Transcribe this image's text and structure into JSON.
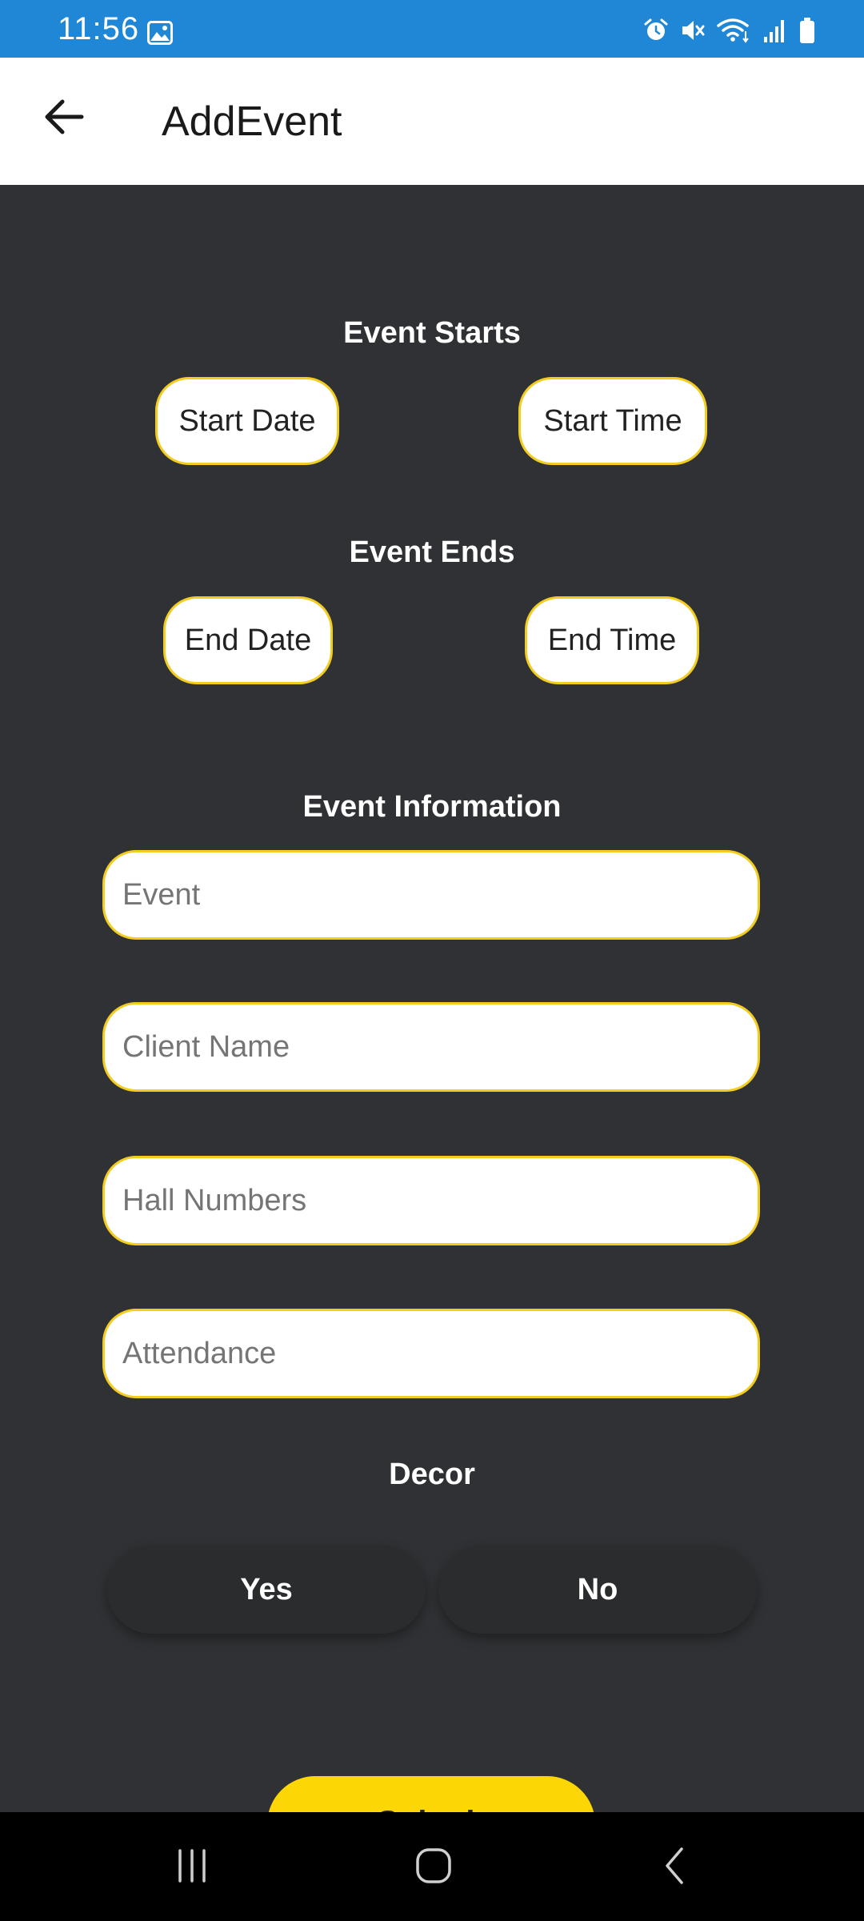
{
  "status_bar": {
    "time": "11:56",
    "icons": [
      "image-icon",
      "alarm-icon",
      "mute-icon",
      "wifi-icon",
      "signal-icon",
      "battery-icon"
    ],
    "color": "#1f87d6"
  },
  "app_bar": {
    "title": "AddEvent",
    "back_icon": "arrow-left-icon"
  },
  "event_starts": {
    "heading": "Event Starts",
    "start_date_label": "Start Date",
    "start_time_label": "Start Time"
  },
  "event_ends": {
    "heading": "Event Ends",
    "end_date_label": "End Date",
    "end_time_label": "End Time"
  },
  "event_information": {
    "heading": "Event Information",
    "fields": [
      {
        "placeholder": "Event",
        "value": ""
      },
      {
        "placeholder": "Client Name",
        "value": ""
      },
      {
        "placeholder": "Hall Numbers",
        "value": ""
      },
      {
        "placeholder": "Attendance",
        "value": ""
      }
    ]
  },
  "decor": {
    "heading": "Decor",
    "yes_label": "Yes",
    "no_label": "No"
  },
  "submit": {
    "label": "Submit",
    "color": "#fdd605"
  },
  "nav_bar": {
    "icons": [
      "recents-icon",
      "home-icon",
      "back-icon"
    ]
  },
  "colors": {
    "background": "#2f3134",
    "accent_border": "#f2cc1f"
  }
}
